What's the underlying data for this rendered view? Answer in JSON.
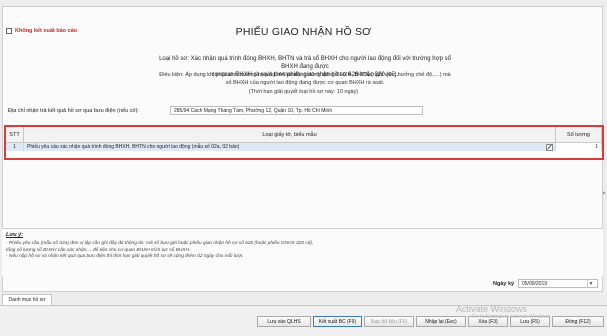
{
  "no_report": {
    "label": "Không kết xuất báo cáo"
  },
  "title": "PHIẾU GIAO NHẬN HỒ SƠ",
  "subtitle_lines": [
    "Loại hồ sơ: Xác nhận quá trình đóng BHXH, BHTN và trả sổ BHXH cho người lao động đối với trường hợp sổ BHXH đang được",
    "cơ quan BHXH rà soát theo phiếu giao nhận hồ sơ 626 hoặc 320 (cũ)."
  ],
  "condition_lines": [
    "Điều kiện: Áp dụng khi phát sinh trường hợp người lao động dừng đóng BHXH, BHTN (nghỉ việc, hưởng chế độ,....) mà",
    "sổ BHXH của người lao động đang được cơ quan BHXH rà soát."
  ],
  "deadline": "(Thời hạn giải quyết loại hồ sơ này: 10 ngày)",
  "address": {
    "label": "Địa chỉ nhận trả kết quả hồ sơ qua bưu điện (nếu có):",
    "value": "285/94 Cách Mạng Tháng Tám, Phường 12, Quận 10, Tp. Hồ Chí Minh"
  },
  "grid": {
    "headers": {
      "stt": "STT",
      "doc": "Loại giấy tờ, biểu mẫu",
      "qty": "Số lượng"
    },
    "rows": [
      {
        "stt": "1",
        "doc": "Phiếu yêu cầu xác nhận quá trình đóng BHXH, BHTN cho người lao động (mẫu số 02a, 02 bản)",
        "qty": "1"
      }
    ]
  },
  "notes": {
    "title": "Lưu ý:",
    "lines": [
      "- Phiếu yêu cầu (mẫu số 02a) đơn vị lập cần ghi đầy đủ thông tin: mã số bưu gửi hoặc phiếu giao nhận hồ sơ số 626 (hoặc phiếu GNHS 320 cũ),",
      "tổng số lượng sổ BHXH cần xác nhận,... để tiện cho cơ quan BHXH trích lục sổ BHXH.",
      "- Nếu nộp hồ sơ và nhận kết quả qua bưu điện thì thời hạn giải quyết hồ sơ sẽ cộng thêm 02 ngày cho mỗi lượt."
    ]
  },
  "date": {
    "label": "Ngày ký",
    "value": "05/09/2019"
  },
  "tab": {
    "label": "Danh mục hồ sơ"
  },
  "buttons": {
    "save": "Lưu vào QLHS",
    "export": "Kết xuất BC (F9)",
    "submit": "Nạp dữ liệu (F6)",
    "reload": "Nhập lại (Esc)",
    "delete": "Xóa (F3)",
    "store": "Lưu (F5)",
    "close": "Đóng (F12)"
  },
  "watermark": {
    "line1": "Activate Windows",
    "line2": "Go to Settings to activate Windows."
  }
}
